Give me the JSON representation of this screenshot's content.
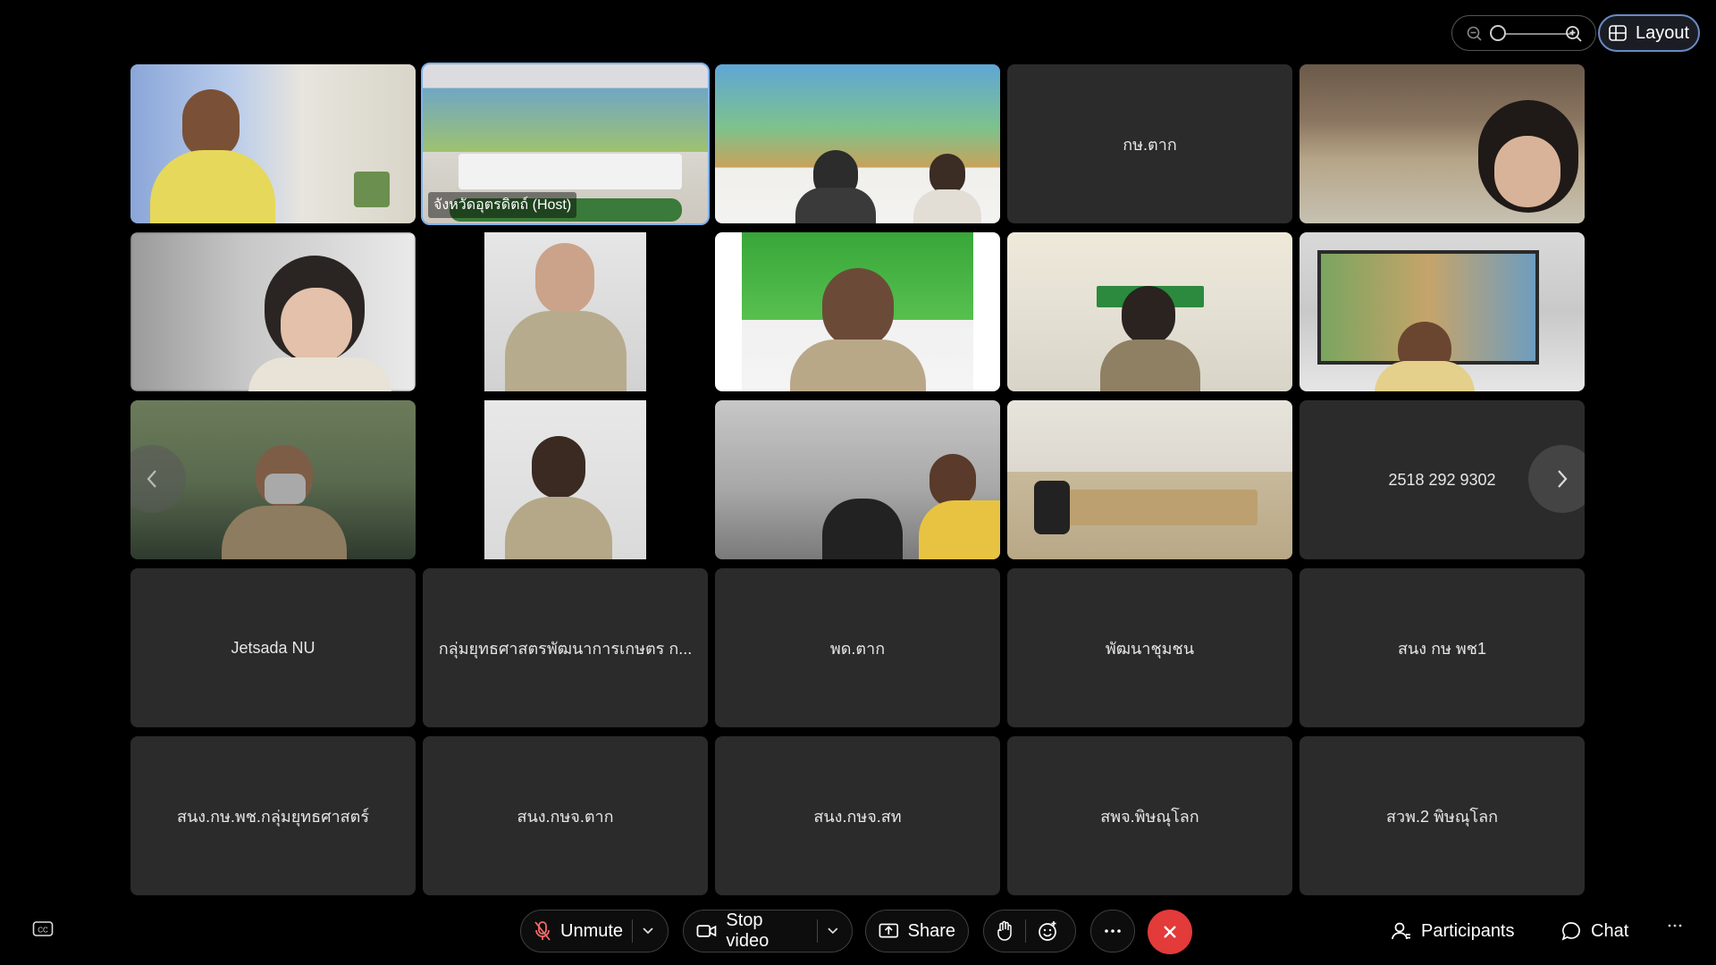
{
  "toolbar_top": {
    "layout_label": "Layout"
  },
  "participants": [
    {
      "name": ""
    },
    {
      "name": "จังหวัดอุตรดิตถ์ (Host)"
    },
    {
      "name": ""
    },
    {
      "name": "กษ.ตาก"
    },
    {
      "name": ""
    },
    {
      "name": ""
    },
    {
      "name": ""
    },
    {
      "name": ""
    },
    {
      "name": ""
    },
    {
      "name": ""
    },
    {
      "name": ""
    },
    {
      "name": ""
    },
    {
      "name": ""
    },
    {
      "name": ""
    },
    {
      "name": "2518 292 9302"
    },
    {
      "name": "Jetsada NU"
    },
    {
      "name": "กลุ่มยุทธศาสตรพัฒนาการเกษตร ก..."
    },
    {
      "name": "พด.ตาก"
    },
    {
      "name": "พัฒนาชุมชน"
    },
    {
      "name": "สนง กษ พช1"
    },
    {
      "name": "สนง.กษ.พช.กลุ่มยุทธศาสตร์"
    },
    {
      "name": "สนง.กษจ.ตาก"
    },
    {
      "name": "สนง.กษจ.สท"
    },
    {
      "name": "สพจ.พิษณุโลก"
    },
    {
      "name": "สวพ.2 พิษณุโลก"
    }
  ],
  "controls": {
    "unmute": "Unmute",
    "stop_video": "Stop video",
    "share": "Share",
    "participants": "Participants",
    "chat": "Chat"
  }
}
